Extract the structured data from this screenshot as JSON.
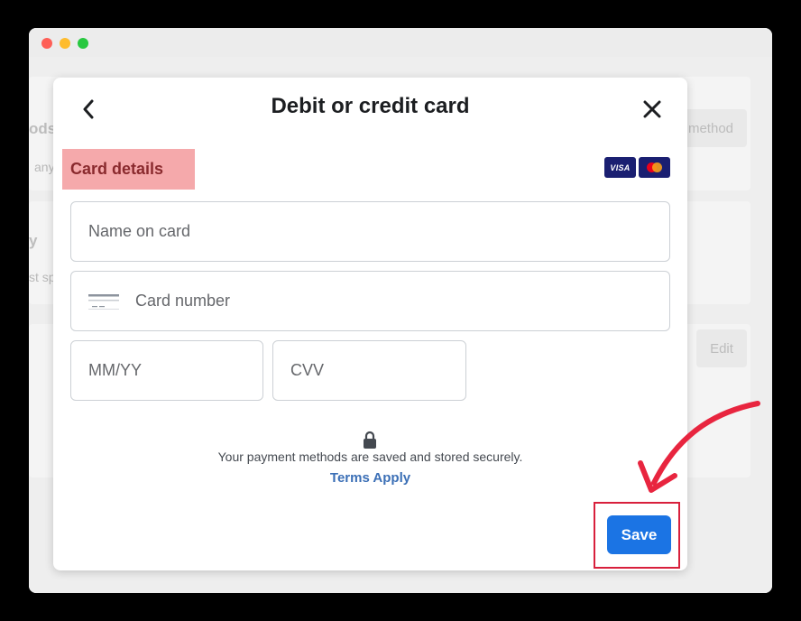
{
  "background_page": {
    "text_methods": "ods",
    "text_any": "any",
    "text_y": "y",
    "text_sp": "st sp",
    "btn_method": "method",
    "btn_edit": "Edit"
  },
  "modal": {
    "title": "Debit or credit card",
    "back_icon": "chevron-left-icon",
    "close_icon": "close-icon",
    "section_label": "Card details",
    "brands": {
      "visa_label": "VISA",
      "mastercard_icon": "mastercard-logo"
    },
    "fields": {
      "name_placeholder": "Name on card",
      "card_number_placeholder": "Card number",
      "expiry_placeholder": "MM/YY",
      "cvv_placeholder": "CVV"
    },
    "secure_text": "Your payment methods are saved and stored securely.",
    "terms_link": "Terms Apply",
    "save_label": "Save"
  },
  "colors": {
    "primary_button": "#1b74e4",
    "link": "#3b6fb6",
    "highlight_label": "#f5a9ab",
    "annotation_red": "#d8203c"
  }
}
